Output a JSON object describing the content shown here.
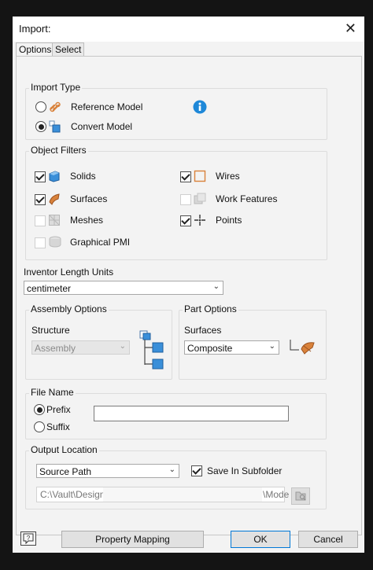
{
  "window": {
    "title": "Import:",
    "close_icon": "close-icon"
  },
  "tabs": [
    {
      "label": "Options",
      "active": true
    },
    {
      "label": "Select",
      "active": false
    }
  ],
  "import_type": {
    "label": "Import Type",
    "options": [
      {
        "label": "Reference Model",
        "selected": false,
        "icon": "link-icon"
      },
      {
        "label": "Convert Model",
        "selected": true,
        "icon": "convert-model-icon"
      }
    ],
    "info_icon": "info-icon"
  },
  "object_filters": {
    "label": "Object Filters",
    "items": [
      {
        "label": "Solids",
        "checked": true,
        "enabled": true,
        "icon": "solid-cube-icon"
      },
      {
        "label": "Wires",
        "checked": true,
        "enabled": true,
        "icon": "wire-box-icon"
      },
      {
        "label": "Surfaces",
        "checked": true,
        "enabled": true,
        "icon": "surface-icon"
      },
      {
        "label": "Work Features",
        "checked": false,
        "enabled": false,
        "icon": "work-features-icon"
      },
      {
        "label": "Meshes",
        "checked": false,
        "enabled": false,
        "icon": "mesh-icon"
      },
      {
        "label": "Points",
        "checked": true,
        "enabled": true,
        "icon": "point-icon"
      },
      {
        "label": "Graphical PMI",
        "checked": false,
        "enabled": false,
        "icon": "graphical-pmi-icon"
      }
    ]
  },
  "length_units": {
    "label": "Inventor Length Units",
    "value": "centimeter"
  },
  "assembly_options": {
    "label": "Assembly Options",
    "structure_label": "Structure",
    "structure_value": "Assembly",
    "icon": "assembly-structure-icon"
  },
  "part_options": {
    "label": "Part Options",
    "surfaces_label": "Surfaces",
    "surfaces_value": "Composite",
    "icon": "composite-surface-icon"
  },
  "file_name": {
    "label": "File Name",
    "options": [
      {
        "label": "Prefix",
        "selected": true
      },
      {
        "label": "Suffix",
        "selected": false
      }
    ],
    "value": ""
  },
  "output_location": {
    "label": "Output Location",
    "location_value": "Source Path",
    "save_in_subfolder_label": "Save In Subfolder",
    "save_in_subfolder_checked": true,
    "path_value": "C:\\Vault\\Designs",
    "path_suffix": "\\Mode",
    "browse_icon": "browse-folder-icon"
  },
  "footer": {
    "help_icon": "help-icon",
    "property_mapping_label": "Property Mapping",
    "ok_label": "OK",
    "cancel_label": "Cancel"
  },
  "colors": {
    "accent": "#0078d7",
    "info": "#1e88d8",
    "solid": "#3a8fd9",
    "surface": "#d9823b"
  }
}
